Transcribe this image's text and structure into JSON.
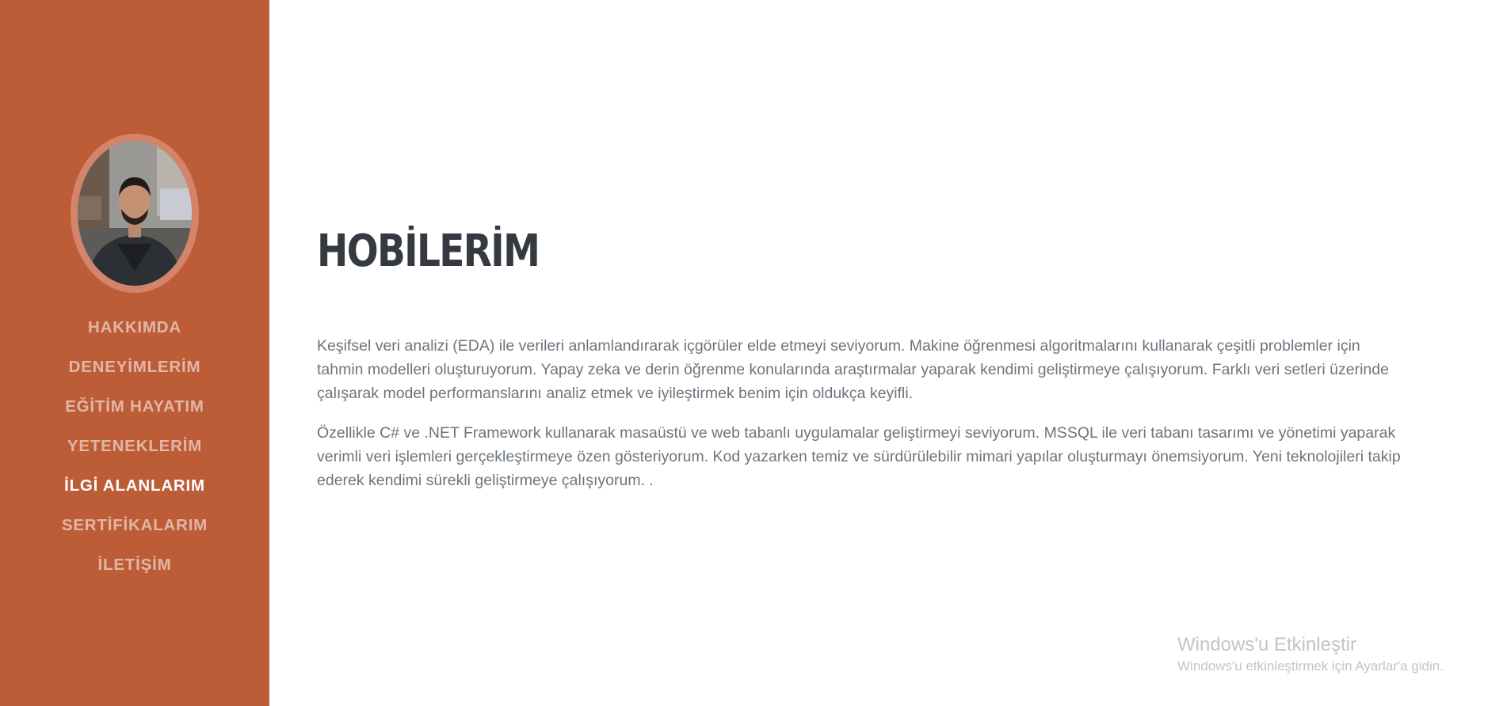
{
  "sidebar": {
    "avatar_alt": "profile photo",
    "nav": [
      {
        "label": "HAKKIMDA",
        "active": false
      },
      {
        "label": "DENEYİMLERİM",
        "active": false
      },
      {
        "label": "EĞİTİM HAYATIM",
        "active": false
      },
      {
        "label": "YETENEKLERİM",
        "active": false
      },
      {
        "label": "İLGİ ALANLARIM",
        "active": true
      },
      {
        "label": "SERTİFİKALARIM",
        "active": false
      },
      {
        "label": "İLETİŞİM",
        "active": false
      }
    ]
  },
  "main": {
    "title": "HOBİLERİM",
    "paragraphs": [
      "Keşifsel veri analizi (EDA) ile verileri anlamlandırarak içgörüler elde etmeyi seviyorum. Makine öğrenmesi algoritmalarını kullanarak çeşitli problemler için tahmin modelleri oluşturuyorum. Yapay zeka ve derin öğrenme konularında araştırmalar yaparak kendimi geliştirmeye çalışıyorum. Farklı veri setleri üzerinde çalışarak model performanslarını analiz etmek ve iyileştirmek benim için oldukça keyifli.",
      "Özellikle C# ve .NET Framework kullanarak masaüstü ve web tabanlı uygulamalar geliştirmeyi seviyorum. MSSQL ile veri tabanı tasarımı ve yönetimi yaparak verimli veri işlemleri gerçekleştirmeye özen gösteriyorum. Kod yazarken temiz ve sürdürülebilir mimari yapılar oluşturmayı önemsiyorum. Yeni teknolojileri takip ederek kendimi sürekli geliştirmeye çalışıyorum. ."
    ]
  },
  "watermark": {
    "title": "Windows'u Etkinleştir",
    "subtitle": "Windows'u etkinleştirmek için Ayarlar'a gidin."
  },
  "colors": {
    "sidebar": "#bd5d38",
    "avatar_ring": "#d3846a",
    "title": "#343a40",
    "body_text": "#6c757d",
    "nav_inactive": "rgba(255,255,255,0.55)",
    "nav_active": "#ffffff"
  }
}
